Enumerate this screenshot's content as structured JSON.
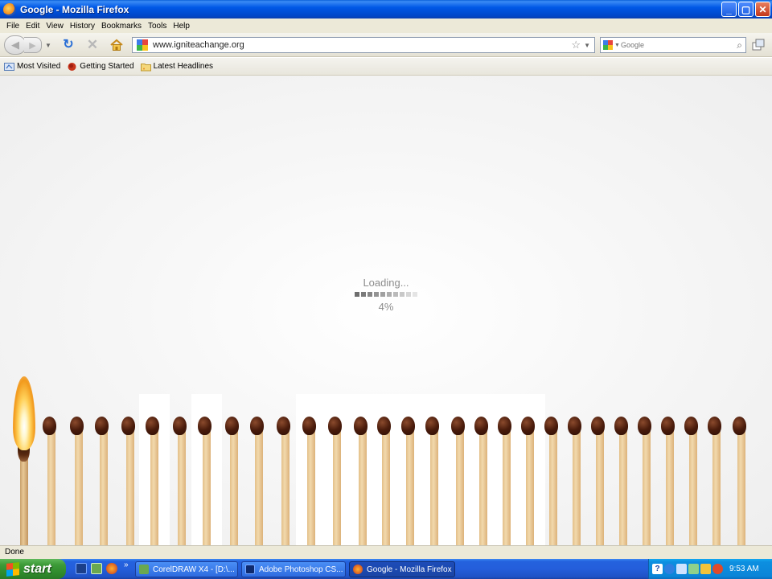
{
  "window": {
    "title": "Google - Mozilla Firefox"
  },
  "menu": [
    "File",
    "Edit",
    "View",
    "History",
    "Bookmarks",
    "Tools",
    "Help"
  ],
  "nav": {
    "url": "www.igniteachange.org",
    "search_placeholder": "Google"
  },
  "bookmarks": [
    {
      "label": "Most Visited",
      "icon": "most-visited-icon"
    },
    {
      "label": "Getting Started",
      "icon": "firefox-icon"
    },
    {
      "label": "Latest Headlines",
      "icon": "rss-folder-icon"
    }
  ],
  "loader": {
    "label": "Loading...",
    "percent_text": "4%",
    "progress": 0.04
  },
  "status": {
    "text": "Done"
  },
  "taskbar": {
    "start_label": "start",
    "tasks": [
      {
        "label": "CorelDRAW X4 - [D:\\...",
        "icon": "coreldraw-icon"
      },
      {
        "label": "Adobe Photoshop CS...",
        "icon": "photoshop-icon"
      },
      {
        "label": "Google - Mozilla Firefox",
        "icon": "firefox-icon",
        "active": true
      }
    ],
    "clock": "9:53 AM"
  },
  "colors": {
    "titlebar": "#0058e6",
    "match_head": "#4a1c0c",
    "match_stick": "#f2d9ad",
    "loader_text": "#8c8c8c"
  }
}
